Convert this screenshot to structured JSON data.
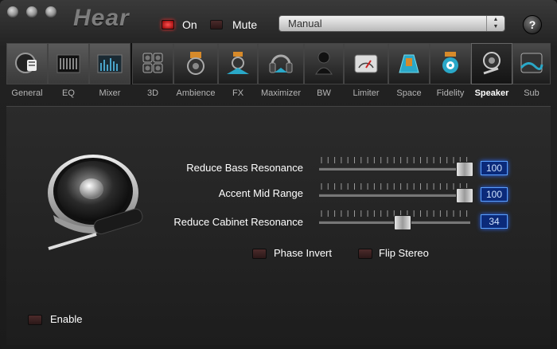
{
  "titlebar": {
    "app_title": "Hear",
    "on_label": "On",
    "mute_label": "Mute",
    "preset_value": "Manual",
    "help_label": "?"
  },
  "tabs": [
    {
      "label": "General",
      "icon": "general-icon"
    },
    {
      "label": "EQ",
      "icon": "eq-icon"
    },
    {
      "label": "Mixer",
      "icon": "mixer-icon"
    },
    {
      "label": "3D",
      "icon": "3d-speakers-icon"
    },
    {
      "label": "Ambience",
      "icon": "ambience-icon"
    },
    {
      "label": "FX",
      "icon": "fx-icon"
    },
    {
      "label": "Maximizer",
      "icon": "maximizer-icon"
    },
    {
      "label": "BW",
      "icon": "bw-icon"
    },
    {
      "label": "Limiter",
      "icon": "limiter-icon"
    },
    {
      "label": "Space",
      "icon": "space-icon"
    },
    {
      "label": "Fidelity",
      "icon": "fidelity-icon"
    },
    {
      "label": "Speaker",
      "icon": "speaker-icon",
      "active": true
    },
    {
      "label": "Sub",
      "icon": "sub-icon"
    }
  ],
  "controls": [
    {
      "label": "Reduce Bass Resonance",
      "value": "100",
      "level": 100
    },
    {
      "label": "Accent Mid Range",
      "value": "100",
      "level": 100
    },
    {
      "label": "Reduce Cabinet Resonance",
      "value": "34",
      "level": 34
    }
  ],
  "options": {
    "phase_invert": "Phase Invert",
    "flip_stereo": "Flip Stereo",
    "enable": "Enable"
  },
  "colors": {
    "accent_blue": "#5aa0ff",
    "led_red": "#ff3030",
    "panel_dark": "#1d1d1d"
  }
}
